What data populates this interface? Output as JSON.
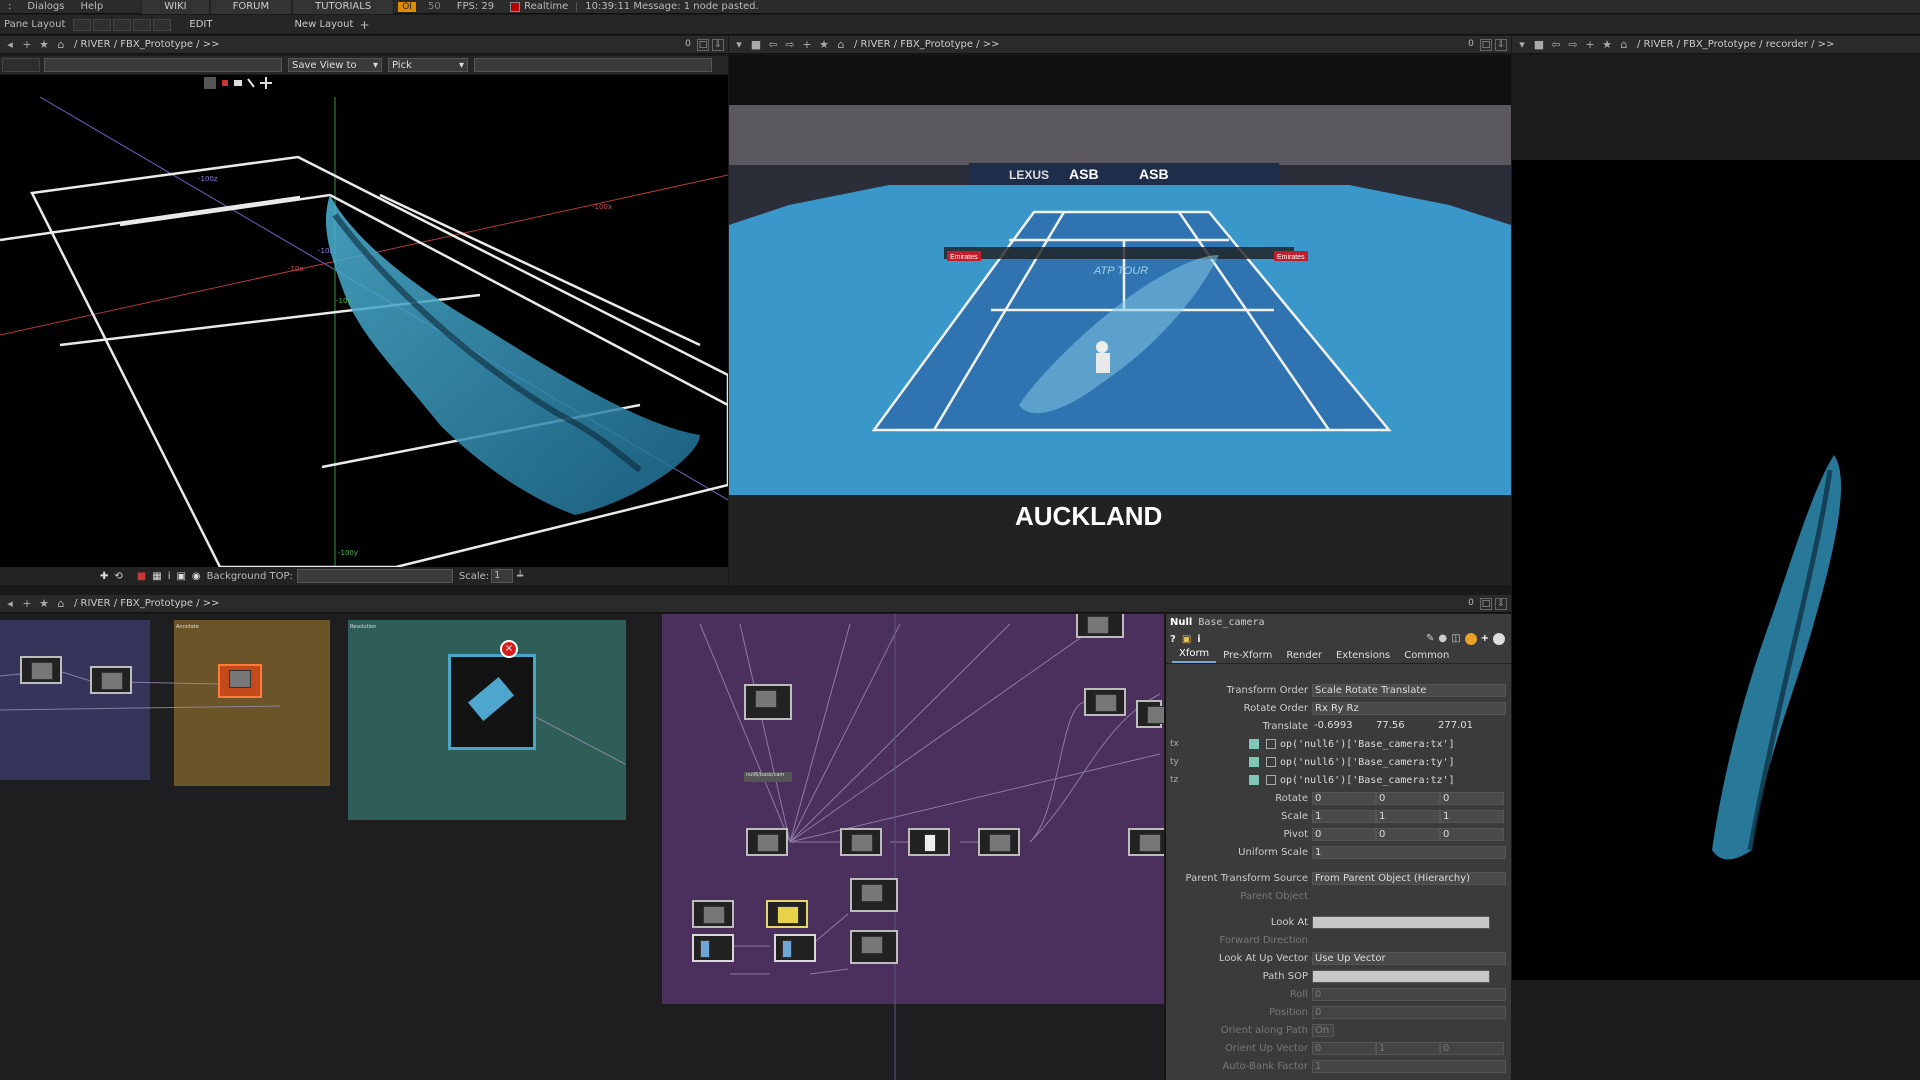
{
  "menubar": {
    "items": [
      ":",
      "Dialogs",
      "Help"
    ],
    "tabs": [
      "WIKI",
      "FORUM",
      "TUTORIALS"
    ],
    "oi": "OI",
    "fps_prefix": "50",
    "fps": "FPS:  29",
    "realtime": "Realtime",
    "message": "10:39:11 Message: 1 node pasted."
  },
  "layoutbar": {
    "pane_layout": "Pane Layout",
    "edit": "EDIT",
    "new_layout": "New Layout"
  },
  "panes": {
    "viewer": {
      "path": "/ RIVER / FBX_Prototype / >>",
      "counter": "0",
      "save_view": "Save View to",
      "pick": "Pick",
      "background_label": "Background TOP:",
      "scale_label": "Scale:",
      "scale_value": "1"
    },
    "video": {
      "path": "/ RIVER / FBX_Prototype / >>",
      "counter": "0"
    },
    "recorder": {
      "path": "/ RIVER / FBX_Prototype / recorder / >>",
      "counter": "0"
    },
    "network": {
      "path": "/ RIVER / FBX_Prototype / >>",
      "counter": "0"
    }
  },
  "scene": {
    "court_banner": "AUCKLAND",
    "sponsor_left": "ASB",
    "sponsor_right": "ASB",
    "lexus": "LEXUS",
    "emirates": "Emirates",
    "atp": "ATP TOUR",
    "axis_labels": [
      "-100z",
      "-100x",
      "-10x",
      "-10y",
      "-100y",
      "-10z"
    ]
  },
  "params": {
    "op_type": "Null",
    "op_name": "Base_camera",
    "tabs": [
      "Xform",
      "Pre-Xform",
      "Render",
      "Extensions",
      "Common"
    ],
    "transform_order_label": "Transform Order",
    "transform_order": "Scale Rotate Translate",
    "rotate_order_label": "Rotate Order",
    "rotate_order": "Rx Ry Rz",
    "translate_label": "Translate",
    "translate": [
      "-0.6993",
      "77.56",
      "277.01"
    ],
    "tx_expr": "op('null6')['Base_camera:tx']",
    "ty_expr": "op('null6')['Base_camera:ty']",
    "tz_expr": "op('null6')['Base_camera:tz']",
    "rotate_label": "Rotate",
    "rotate": [
      "0",
      "0",
      "0"
    ],
    "scale_label": "Scale",
    "scale": [
      "1",
      "1",
      "1"
    ],
    "pivot_label": "Pivot",
    "pivot": [
      "0",
      "0",
      "0"
    ],
    "uniform_scale_label": "Uniform Scale",
    "uniform_scale": "1",
    "parent_source_label": "Parent Transform Source",
    "parent_source": "From Parent Object (Hierarchy)",
    "parent_object_label": "Parent Object",
    "look_at_label": "Look At",
    "forward_dir_label": "Forward Direction",
    "look_up_label": "Look At Up Vector",
    "look_up": "Use Up Vector",
    "path_sop_label": "Path SOP",
    "roll_label": "Roll",
    "roll": "0",
    "position_label": "Position",
    "position": "0",
    "orient_path_label": "Orient along Path",
    "orient_path": "On",
    "orient_up_label": "Orient Up Vector",
    "orient_up": [
      "0",
      "1",
      "0"
    ],
    "auto_bank_label": "Auto-Bank Factor",
    "auto_bank": "1",
    "ch": [
      "tx",
      "ty",
      "tz"
    ]
  },
  "network": {
    "box_titles": [
      "Annotate",
      "Resolution",
      "Snapshot"
    ],
    "node_label": "null6/base/cam"
  },
  "colors": {
    "accent": "#e08a00",
    "pointcloud": "#3fa3c6",
    "court_blue": "#3a97c9"
  }
}
